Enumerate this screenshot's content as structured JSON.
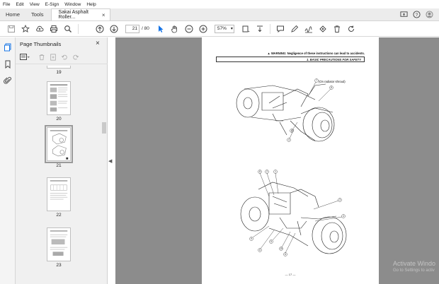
{
  "menu": [
    "File",
    "Edit",
    "View",
    "E-Sign",
    "Window",
    "Help"
  ],
  "tabs": {
    "home": "Home",
    "tools": "Tools",
    "document": "Sakai Asphalt Roller...",
    "close": "×"
  },
  "toolbar": {
    "page_current": "21",
    "page_total": "/ 80",
    "zoom": "57%"
  },
  "panel": {
    "title": "Page Thumbnails",
    "close": "×",
    "thumbnails": [
      {
        "label": "19"
      },
      {
        "label": "20"
      },
      {
        "label": "21",
        "selected": true
      },
      {
        "label": "22"
      },
      {
        "label": "23"
      }
    ]
  },
  "document": {
    "warning": "▲ WARNING: Negligence of these instructions can lead to accidents.",
    "section": "1.  BASIC PRECAUTIONS FOR SAFETY",
    "radiator_note": "(On radiator shroud)",
    "page_number": "— 17 —",
    "callouts_top": [
      "7",
      "8",
      "4",
      "5"
    ],
    "callouts_bottom": [
      "8",
      "2",
      "1",
      "3",
      "4",
      "5",
      "9",
      "10",
      "6",
      "6"
    ]
  },
  "watermark": {
    "line1": "Activate Windo",
    "line2": "Go to Settings to activ"
  },
  "colors": {
    "accent": "#1473e6",
    "viewer_bg": "#8c8c8c"
  }
}
